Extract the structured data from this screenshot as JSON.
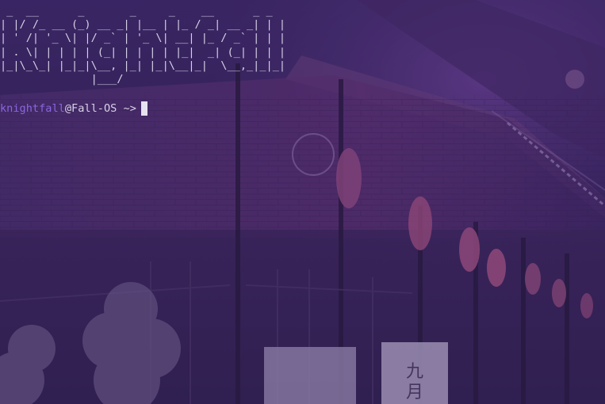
{
  "terminal": {
    "banner_lines": [
      " _  __      _       _     _    __      _ _ ",
      "| |/ /_ __ (_) __ _| |__ | |_ / _| __ _| | |",
      "| ' /| '_ \\| |/ _` | '_ \\| __| |_ / _` | | |",
      "| . \\| | | | | (_| | | | | |_|  _| (_| | | |",
      "|_|\\_\\_| |_|_|\\__, |_| |_|\\__|_|  \\__,_|_|_|",
      "              |___/                           "
    ],
    "prompt": {
      "user": "knightfall",
      "at": "@",
      "host": "Fall-OS",
      "path": "~",
      "arrow": ">"
    }
  },
  "colors": {
    "prompt_user": "#8a66e0",
    "text": "#d8d2e8",
    "cursor": "#e6e2f0",
    "overlay": "#3a2466"
  },
  "wallpaper": {
    "sign_text": "九月"
  }
}
